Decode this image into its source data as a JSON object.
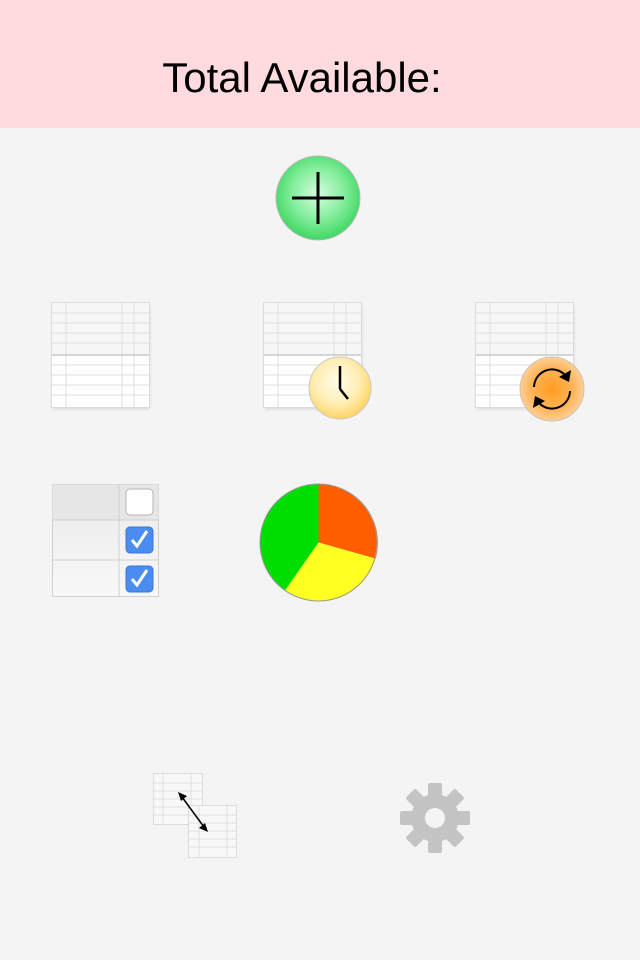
{
  "header": {
    "title": "Total Available:",
    "background_color": "#ffdadf"
  },
  "toolbar": {
    "add_icon": "plus-icon",
    "tiles": [
      {
        "name": "spreadsheet",
        "icon": "spreadsheet-icon"
      },
      {
        "name": "spreadsheet-clock",
        "icon": "clock-icon"
      },
      {
        "name": "spreadsheet-sync",
        "icon": "sync-icon"
      },
      {
        "name": "checklist",
        "icon": "checklist-icon",
        "checked": [
          false,
          true,
          true
        ]
      },
      {
        "name": "pie-chart",
        "icon": "pie-chart-icon"
      }
    ],
    "bottom": [
      {
        "name": "resize-sheets",
        "icon": "resize-sheets-icon"
      },
      {
        "name": "settings",
        "icon": "gear-icon"
      }
    ]
  },
  "colors": {
    "page_background": "#f4f4f4",
    "add_button": "#5be37c",
    "clock_badge": "#ffe49a",
    "sync_badge": "#ff9a2e",
    "checkbox_checked": "#4a8cf0",
    "pie_green": "#00dd00",
    "pie_orange": "#ff5e00",
    "pie_yellow": "#ffff22",
    "gear": "#c4c4c4"
  }
}
